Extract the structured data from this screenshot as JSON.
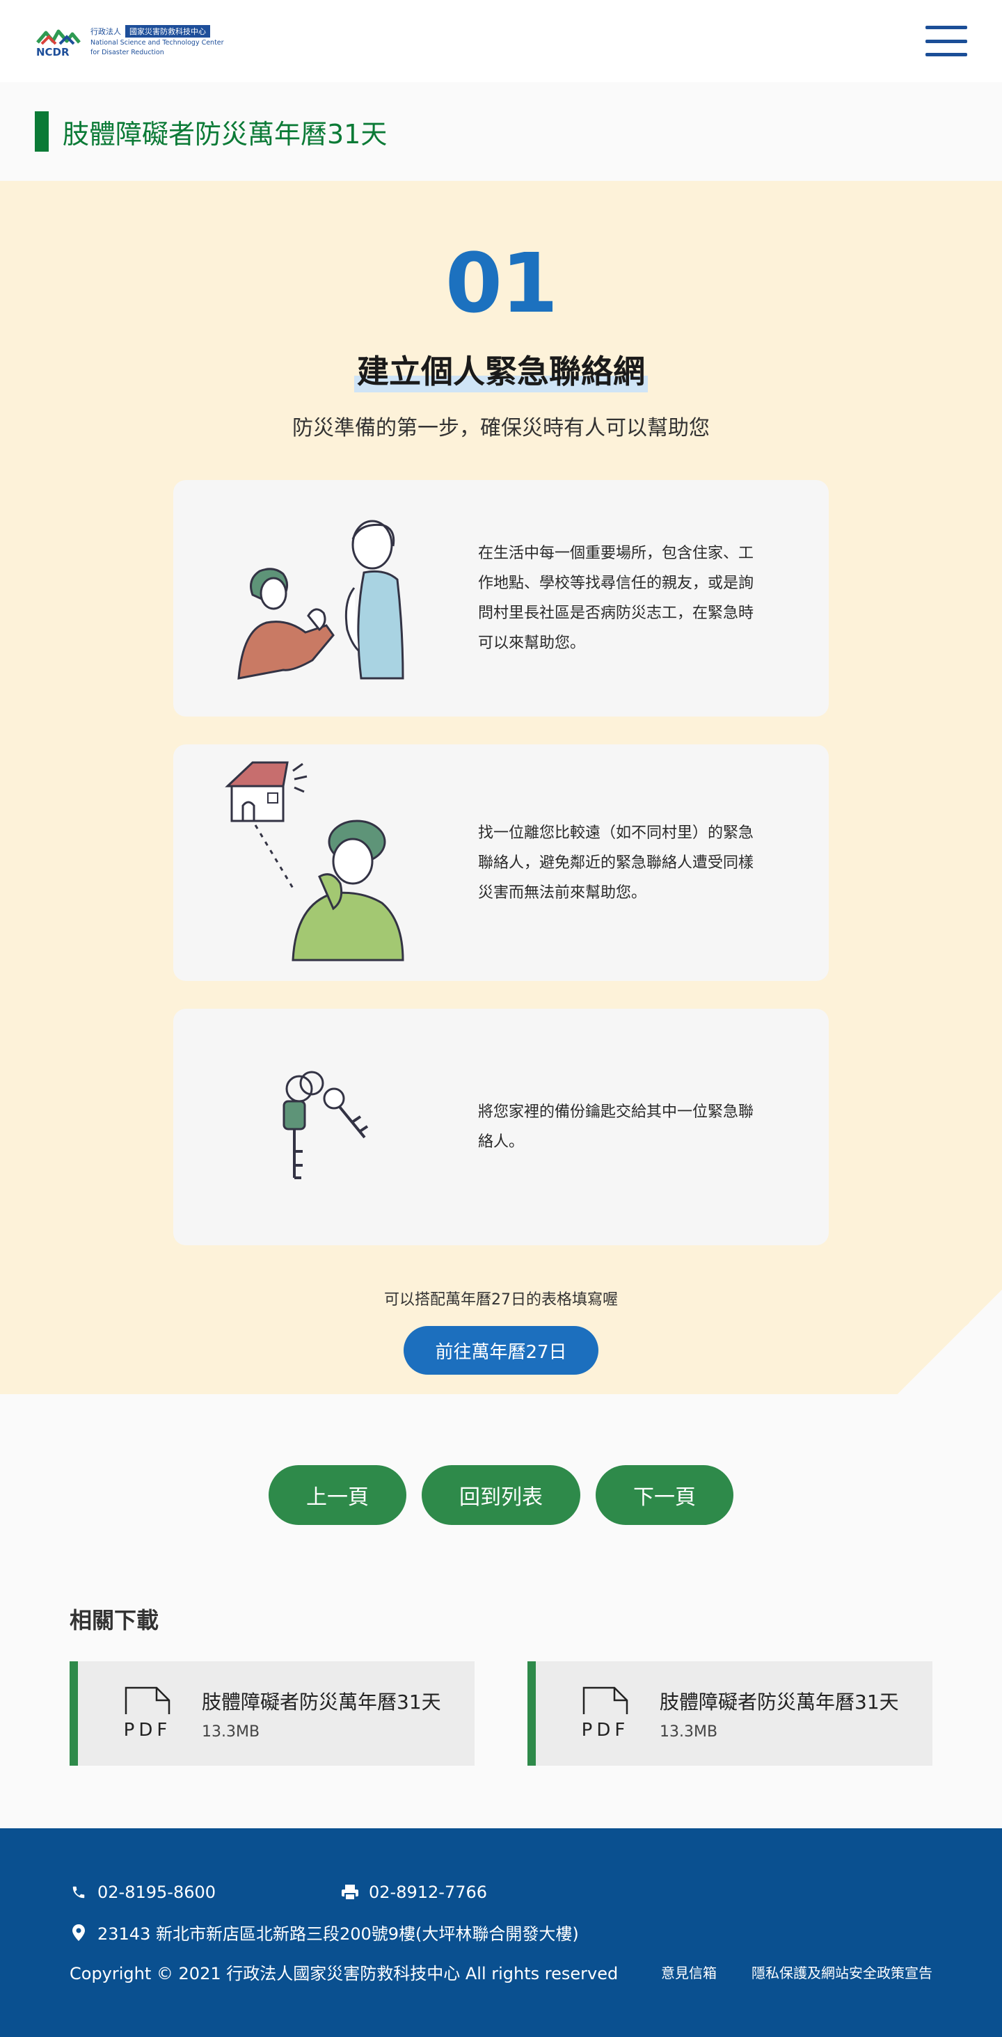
{
  "header": {
    "logo_org_prefix": "行政法人",
    "logo_org_name": "國家災害防救科技中心",
    "logo_en_line1": "National Science and Technology Center",
    "logo_en_line2": "for Disaster Reduction",
    "logo_abbr": "NCDR",
    "menu_icon": "hamburger-menu-icon"
  },
  "page": {
    "title": "肢體障礙者防災萬年曆31天"
  },
  "day": {
    "number": "01",
    "title": "建立個人緊急聯絡網",
    "subtitle": "防災準備的第一步，確保災時有人可以幫助您",
    "cards": [
      {
        "text": "在生活中每一個重要場所，包含住家、工作地點、學校等找尋信任的親友，或是詢問村里長社區是否病防災志工，在緊急時可以來幫助您。",
        "illustration": "people-asking-help-illustration"
      },
      {
        "text": "找一位離您比較遠（如不同村里）的緊急聯絡人，避免鄰近的緊急聯絡人遭受同樣災害而無法前來幫助您。",
        "illustration": "phone-call-house-illustration"
      },
      {
        "text": "將您家裡的備份鑰匙交給其中一位緊急聯絡人。",
        "illustration": "keys-illustration"
      }
    ],
    "hint": "可以搭配萬年曆27日的表格填寫喔",
    "goto_label": "前往萬年曆27日"
  },
  "pager": {
    "prev": "上一頁",
    "list": "回到列表",
    "next": "下一頁"
  },
  "downloads": {
    "heading": "相關下載",
    "items": [
      {
        "type": "PDF",
        "name": "肢體障礙者防災萬年曆31天",
        "size": "13.3MB"
      },
      {
        "type": "PDF",
        "name": "肢體障礙者防災萬年曆31天",
        "size": "13.3MB"
      }
    ]
  },
  "footer": {
    "phone": "02-8195-8600",
    "fax": "02-8912-7766",
    "address": "23143 新北市新店區北新路三段200號9樓(大坪林聯合開發大樓)",
    "copyright": "Copyright © 2021 行政法人國家災害防救科技中心 All rights reserved",
    "links": [
      "意見信箱",
      "隱私保護及網站安全政策宣告"
    ]
  },
  "colors": {
    "brand_green": "#0b7a36",
    "button_green": "#2e8a4a",
    "brand_blue": "#1c71bf",
    "footer_blue": "#0a5090",
    "content_bg": "#fdf2d9"
  }
}
